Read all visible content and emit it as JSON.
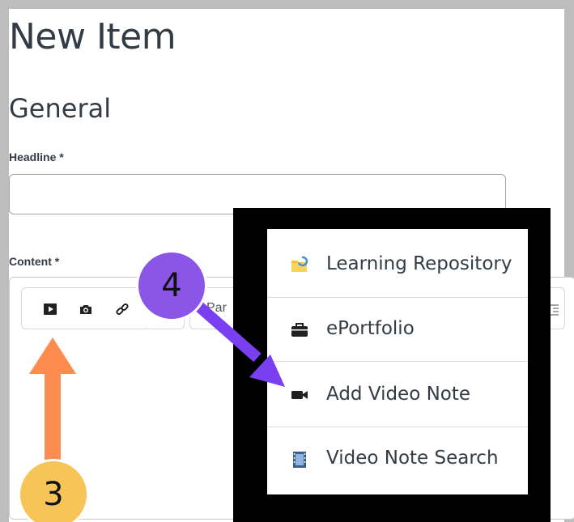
{
  "page": {
    "title": "New Item",
    "section_title": "General",
    "headline_label": "Headline *",
    "headline_value": "",
    "content_label": "Content *",
    "format_select_partial": "Par"
  },
  "toolbar": {
    "icons": [
      "video-icon",
      "camera-icon",
      "link-icon",
      "chevron-down-icon"
    ]
  },
  "menu": {
    "items": [
      {
        "label": "Learning Repository",
        "icon": "learning-repository-icon"
      },
      {
        "label": "ePortfolio",
        "icon": "eportfolio-icon"
      },
      {
        "label": "Add Video Note",
        "icon": "video-camera-icon"
      },
      {
        "label": "Video Note Search",
        "icon": "film-icon"
      }
    ]
  },
  "annotations": {
    "step_3": "3",
    "step_4": "4",
    "step_3_color": "#f7c457",
    "step_4_color": "#8b55e8",
    "arrow_3_color": "#fd8c4e",
    "arrow_4_color": "#7b3ff2"
  }
}
